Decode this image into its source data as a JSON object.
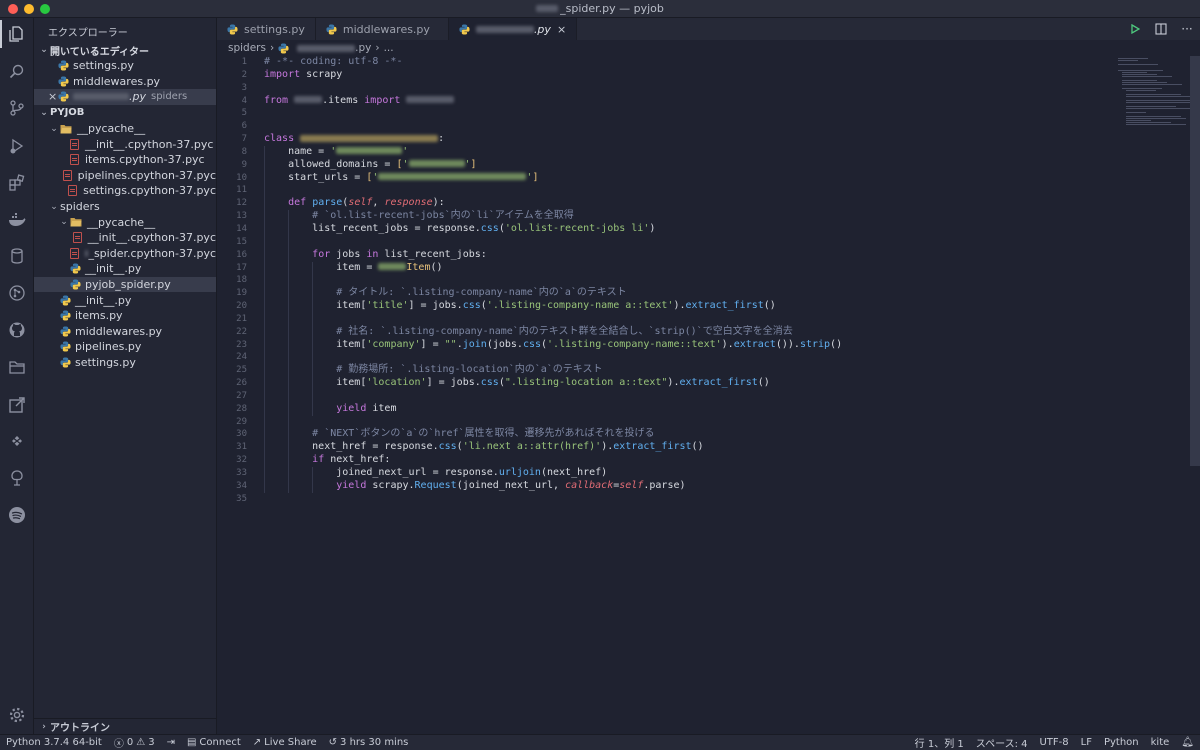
{
  "window": {
    "title_prefix": "",
    "title_suffix": "_spider.py — pyjob"
  },
  "colors": {
    "accent": "#c678dd",
    "python_blue": "#3b77a8",
    "python_yellow": "#f2c94c",
    "pyc_red": "#c0504d"
  },
  "activity_bar": [
    "files-icon",
    "search-icon",
    "source-control-icon",
    "run-debug-icon",
    "extensions-icon",
    "docker-icon",
    "database-icon",
    "git-graph-icon",
    "github-icon",
    "folder-icon",
    "remote-icon",
    "kite-icon",
    "tree-icon",
    "spotify-icon",
    "settings-gear-icon"
  ],
  "sidebar": {
    "title": "エクスプローラー",
    "open_editors_label": "開いているエディター",
    "open_editors": [
      {
        "label": "settings.py"
      },
      {
        "label": "middlewares.py"
      },
      {
        "label_suffix": ".py",
        "folder": "spiders"
      }
    ],
    "project_label": "PYJOB",
    "tree": [
      {
        "label": "__pycache__",
        "type": "folder",
        "depth": 1
      },
      {
        "label": "__init__.cpython-37.pyc",
        "type": "pyc",
        "depth": 2
      },
      {
        "label": "items.cpython-37.pyc",
        "type": "pyc",
        "depth": 2
      },
      {
        "label": "pipelines.cpython-37.pyc",
        "type": "pyc",
        "depth": 2
      },
      {
        "label": "settings.cpython-37.pyc",
        "type": "pyc",
        "depth": 2
      },
      {
        "label": "spiders",
        "type": "folder-chev",
        "depth": 1
      },
      {
        "label": "__pycache__",
        "type": "folder",
        "depth": 2
      },
      {
        "label": "__init__.cpython-37.pyc",
        "type": "pyc",
        "depth": 3
      },
      {
        "label": "_spider.cpython-37.pyc",
        "type": "pyc-blur",
        "depth": 3
      },
      {
        "label": "__init__.py",
        "type": "py",
        "depth": 2
      },
      {
        "label": "pyjob_spider.py",
        "type": "py",
        "depth": 2,
        "selected": true
      },
      {
        "label": "__init__.py",
        "type": "py",
        "depth": 1
      },
      {
        "label": "items.py",
        "type": "py",
        "depth": 1
      },
      {
        "label": "middlewares.py",
        "type": "py",
        "depth": 1
      },
      {
        "label": "pipelines.py",
        "type": "py",
        "depth": 1
      },
      {
        "label": "settings.py",
        "type": "py",
        "depth": 1
      }
    ],
    "outline_label": "アウトライン"
  },
  "tabs": [
    {
      "label": "settings.py"
    },
    {
      "label": "middlewares.py"
    },
    {
      "label": ".py",
      "active": true
    }
  ],
  "breadcrumb": {
    "folder": "spiders",
    "file_suffix": ".py",
    "more": "..."
  },
  "status": {
    "python": "Python 3.7.4 64-bit",
    "errors": "0",
    "warnings": "3",
    "connect": "Connect",
    "live_share": "Live Share",
    "time": "3 hrs 30 mins",
    "position": "行 1、列 1",
    "spaces": "スペース: 4",
    "encoding": "UTF-8",
    "eol": "LF",
    "language": "Python",
    "kite": "kite"
  }
}
